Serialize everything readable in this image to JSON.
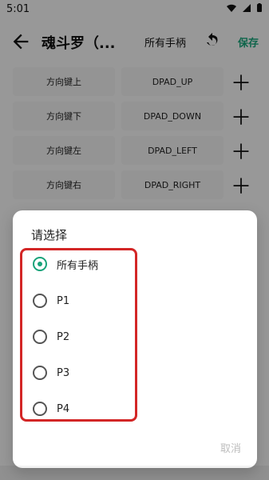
{
  "statusbar": {
    "time": "5:01",
    "icons": [
      "wifi-icon",
      "signal-icon",
      "battery-icon"
    ]
  },
  "topbar": {
    "title": "魂斗罗（...",
    "pad_filter": "所有手柄",
    "save_label": "保存"
  },
  "mapping_rows": [
    {
      "name": "方向键上",
      "key": "DPAD_UP"
    },
    {
      "name": "方向键下",
      "key": "DPAD_DOWN"
    },
    {
      "name": "方向键左",
      "key": "DPAD_LEFT"
    },
    {
      "name": "方向键右",
      "key": "DPAD_RIGHT"
    }
  ],
  "dialog": {
    "title": "请选择",
    "options": [
      {
        "label": "所有手柄",
        "selected": true
      },
      {
        "label": "P1",
        "selected": false
      },
      {
        "label": "P2",
        "selected": false
      },
      {
        "label": "P3",
        "selected": false
      },
      {
        "label": "P4",
        "selected": false
      }
    ],
    "cancel_label": "取消"
  },
  "colors": {
    "accent": "#19a37a",
    "highlight_frame": "#d32626",
    "scrim": "rgba(0,0,0,0.38)"
  }
}
